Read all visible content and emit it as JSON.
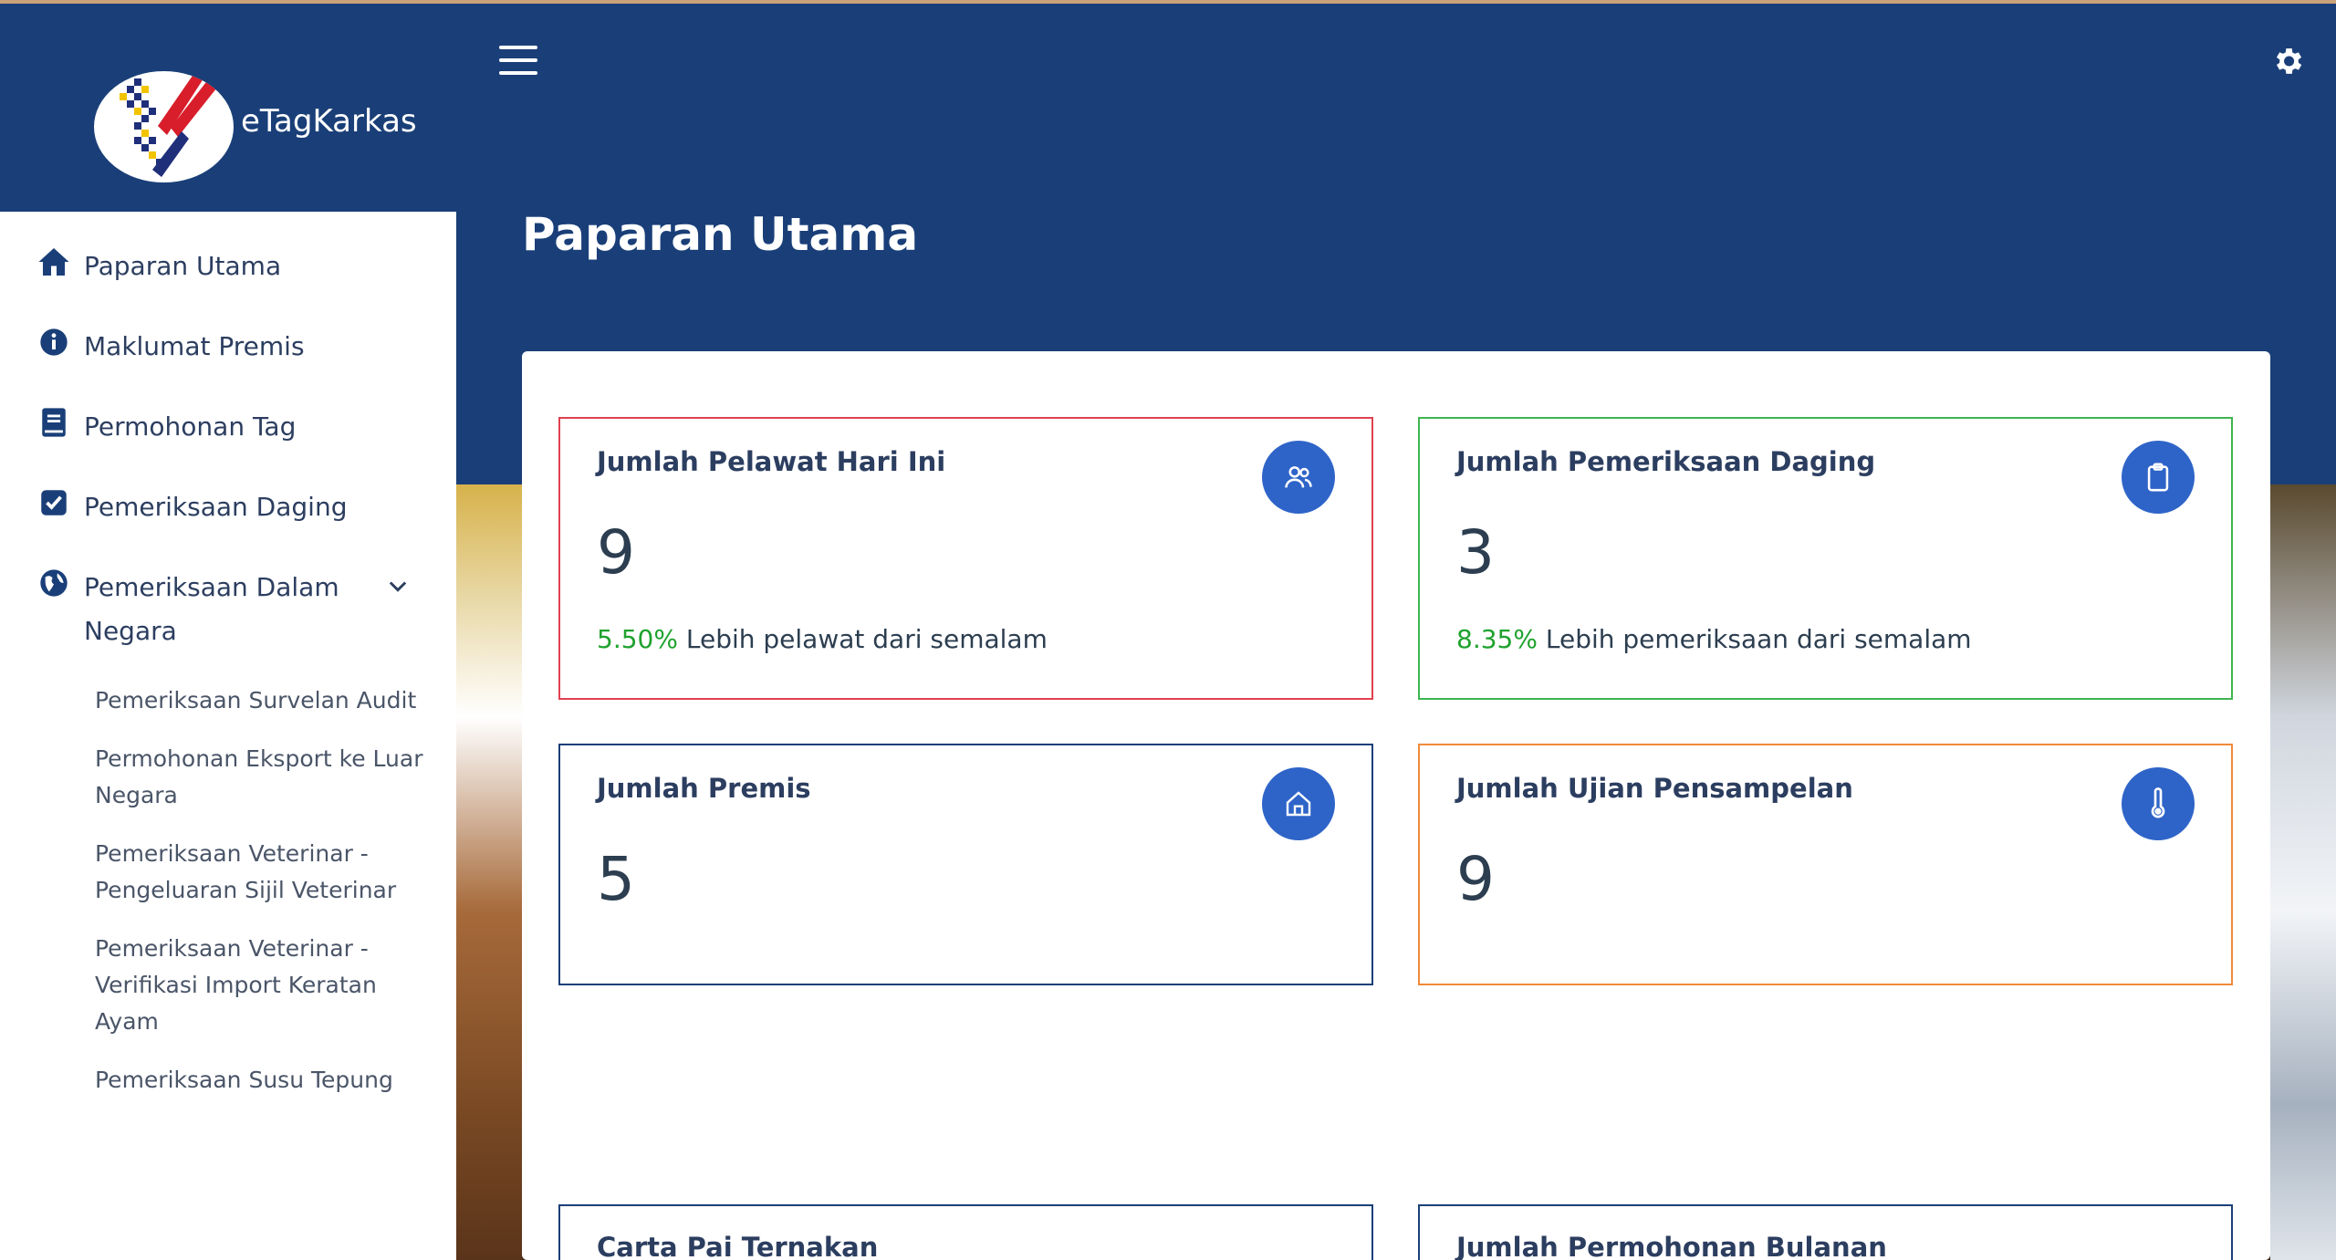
{
  "app": {
    "brand_name": "eTagKarkas"
  },
  "colors": {
    "header": "#1a3f78",
    "badge": "#2e64c8",
    "positive": "#1fa22e",
    "card_red": "#e0414f",
    "card_green": "#3fb550",
    "card_navy": "#1a3f78",
    "card_orange": "#f08a3a"
  },
  "sidebar": {
    "items": [
      {
        "label": "Paparan Utama",
        "icon": "home-icon"
      },
      {
        "label": "Maklumat Premis",
        "icon": "info-icon"
      },
      {
        "label": "Permohonan Tag",
        "icon": "book-icon"
      },
      {
        "label": "Pemeriksaan Daging",
        "icon": "checkbox-icon"
      },
      {
        "label": "Pemeriksaan Dalam Negara",
        "icon": "globe-icon"
      }
    ],
    "submenu": [
      "Pemeriksaan Survelan Audit",
      "Permohonan Eksport ke Luar Negara",
      "Pemeriksaan Veterinar - Pengeluaran Sijil Veterinar",
      "Pemeriksaan Veterinar - Verifikasi Import Keratan Ayam",
      "Pemeriksaan Susu Tepung"
    ]
  },
  "header": {
    "menu_icon": "hamburger-icon",
    "settings_icon": "gear-icon"
  },
  "page": {
    "title": "Paparan Utama"
  },
  "cards": [
    {
      "title": "Jumlah Pelawat Hari Ini",
      "value": "9",
      "trend_pct": "5.50%",
      "trend_text": " Lebih pelawat dari semalam",
      "icon": "users-icon"
    },
    {
      "title": "Jumlah Pemeriksaan Daging",
      "value": "3",
      "trend_pct": "8.35%",
      "trend_text": " Lebih pemeriksaan dari semalam",
      "icon": "clipboard-icon"
    },
    {
      "title": "Jumlah Premis",
      "value": "5",
      "icon": "house-icon"
    },
    {
      "title": "Jumlah Ujian Pensampelan",
      "value": "9",
      "icon": "thermometer-icon"
    }
  ],
  "bottom_cards": [
    {
      "title": "Carta Pai Ternakan"
    },
    {
      "title": "Jumlah Permohonan Bulanan"
    }
  ]
}
